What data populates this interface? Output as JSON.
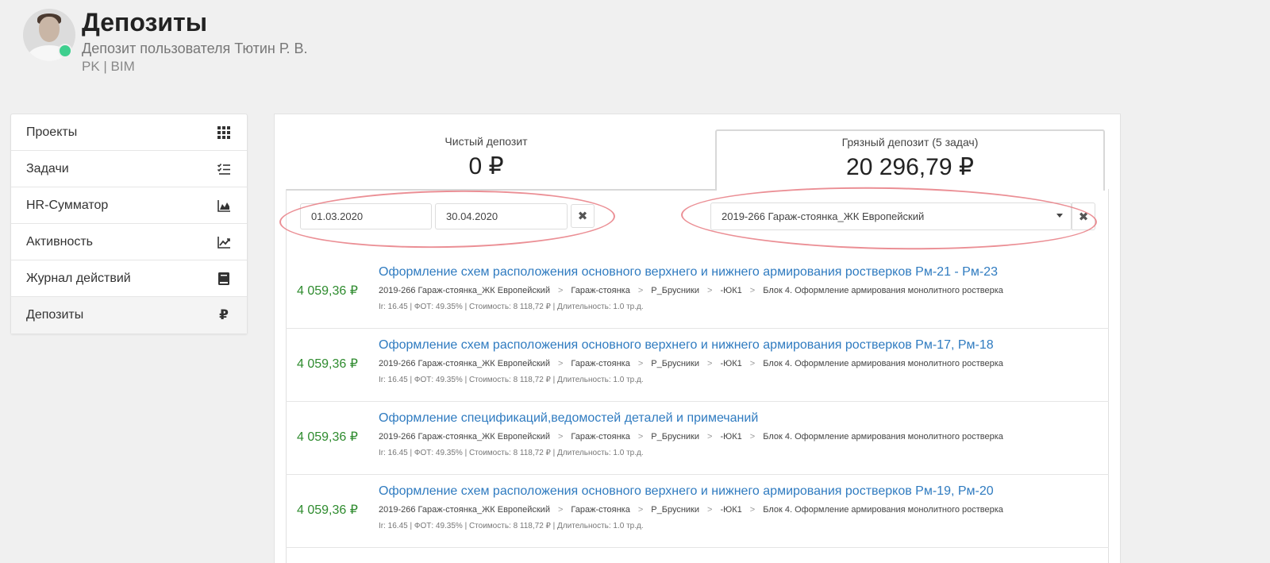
{
  "header": {
    "title": "Депозиты",
    "subtitle": "Депозит пользователя Тютин Р. В.",
    "role": "PK | BIM"
  },
  "sidebar": {
    "items": [
      {
        "label": "Проекты",
        "icon": "grid-icon"
      },
      {
        "label": "Задачи",
        "icon": "checklist-icon"
      },
      {
        "label": "HR-Сумматор",
        "icon": "area-chart-icon"
      },
      {
        "label": "Активность",
        "icon": "line-chart-icon"
      },
      {
        "label": "Журнал действий",
        "icon": "book-icon"
      },
      {
        "label": "Депозиты",
        "icon": "ruble-icon",
        "symbol": "₽",
        "active": true
      }
    ]
  },
  "tabs": {
    "clean": {
      "label": "Чистый депозит",
      "amount": "0 ₽"
    },
    "dirty": {
      "label": "Грязный депозит (5 задач)",
      "amount": "20 296,79 ₽",
      "active": true
    }
  },
  "filters": {
    "date_from": "01.03.2020",
    "date_to": "30.04.2020",
    "project_select": "2019-266 Гараж-стоянка_ЖК Европейский",
    "clear_symbol": "✖"
  },
  "colors": {
    "amount": "#2e8b2e",
    "link": "#2f7bc0",
    "annotation": "#e87b82"
  },
  "tasks": [
    {
      "amount": "4 059,36 ₽",
      "title": "Оформление схем расположения основного верхнего и нижнего армирования ростверков Рм-21 - Рм-23",
      "crumbs": [
        "2019-266 Гараж-стоянка_ЖК Европейский",
        "Гараж-стоянка",
        "Р_Брусники",
        "-ЮК1",
        "Блок 4. Оформление армирования монолитного ростверка"
      ],
      "meta": "Ir: 16.45 | ФОТ: 49.35% | Стоимость: 8 118,72 ₽ | Длительность: 1.0 тр.д."
    },
    {
      "amount": "4 059,36 ₽",
      "title": "Оформление схем расположения основного верхнего и нижнего армирования ростверков Рм-17, Рм-18",
      "crumbs": [
        "2019-266 Гараж-стоянка_ЖК Европейский",
        "Гараж-стоянка",
        "Р_Брусники",
        "-ЮК1",
        "Блок 4. Оформление армирования монолитного ростверка"
      ],
      "meta": "Ir: 16.45 | ФОТ: 49.35% | Стоимость: 8 118,72 ₽ | Длительность: 1.0 тр.д."
    },
    {
      "amount": "4 059,36 ₽",
      "title": "Оформление спецификаций,ведомостей деталей и примечаний",
      "crumbs": [
        "2019-266 Гараж-стоянка_ЖК Европейский",
        "Гараж-стоянка",
        "Р_Брусники",
        "-ЮК1",
        "Блок 4. Оформление армирования монолитного ростверка"
      ],
      "meta": "Ir: 16.45 | ФОТ: 49.35% | Стоимость: 8 118,72 ₽ | Длительность: 1.0 тр.д."
    },
    {
      "amount": "4 059,36 ₽",
      "title": "Оформление схем расположения основного верхнего и нижнего армирования ростверков Рм-19, Рм-20",
      "crumbs": [
        "2019-266 Гараж-стоянка_ЖК Европейский",
        "Гараж-стоянка",
        "Р_Брусники",
        "-ЮК1",
        "Блок 4. Оформление армирования монолитного ростверка"
      ],
      "meta": "Ir: 16.45 | ФОТ: 49.35% | Стоимость: 8 118,72 ₽ | Длительность: 1.0 тр.д."
    }
  ]
}
